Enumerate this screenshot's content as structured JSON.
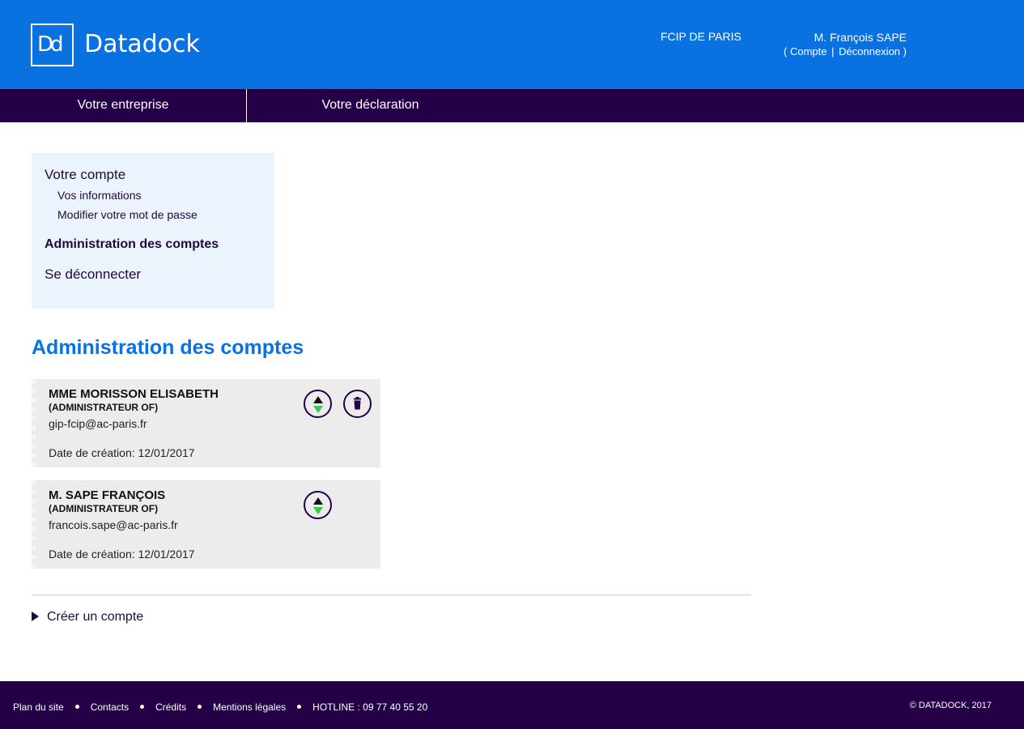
{
  "header": {
    "logo_mark": "Dd",
    "logo_text": "Datadock",
    "organization": "FCIP DE PARIS",
    "user_name": "M. François SAPE",
    "links": {
      "open": "(",
      "account": "Compte",
      "separator": "|",
      "logout": "Déconnexion",
      "close": ")"
    }
  },
  "nav": {
    "items": [
      {
        "label": "Votre entreprise"
      },
      {
        "label": "Votre déclaration"
      }
    ]
  },
  "sidebar": {
    "section_account": "Votre compte",
    "sub_items": [
      {
        "label": "Vos informations"
      },
      {
        "label": "Modifier votre mot de passe"
      }
    ],
    "section_admin": "Administration des comptes",
    "section_logout": "Se déconnecter"
  },
  "main": {
    "title": "Administration des comptes",
    "accounts": [
      {
        "name": "MME MORISSON ELISABETH",
        "role": "(ADMINISTRATEUR OF)",
        "email": "gip-fcip@ac-paris.fr",
        "created": "Date de création: 12/01/2017",
        "deletable": true
      },
      {
        "name": "M. SAPE FRANÇOIS",
        "role": "(ADMINISTRATEUR OF)",
        "email": "francois.sape@ac-paris.fr",
        "created": "Date de création: 12/01/2017",
        "deletable": false
      }
    ],
    "create_account_label": "Créer un compte"
  },
  "footer": {
    "links": [
      {
        "label": "Plan du site"
      },
      {
        "label": "Contacts"
      },
      {
        "label": "Crédits"
      },
      {
        "label": "Mentions légales"
      },
      {
        "label": "HOTLINE : 09 77 40 55 20"
      }
    ],
    "copyright": "© DATADOCK, 2017"
  },
  "colors": {
    "header_blue": "#0a72e0",
    "dark_purple": "#240046",
    "panel_bg": "#ebf3fd",
    "card_bg": "#ececec",
    "sort_down_green": "#2ecc40"
  }
}
